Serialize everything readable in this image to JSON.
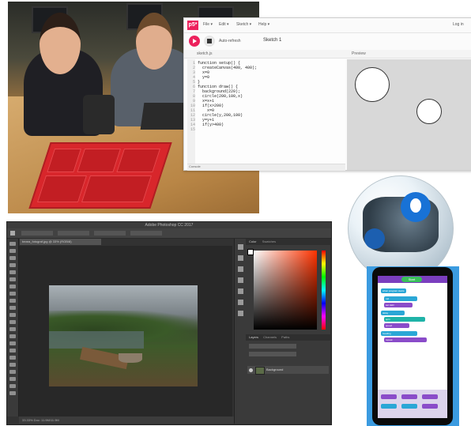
{
  "collage": {
    "p5_editor": {
      "logo": "p5*",
      "menu": [
        "File ▾",
        "Edit ▾",
        "Sketch ▾",
        "Help ▾"
      ],
      "account": "Log in",
      "auto_refresh": "Auto-refresh",
      "sketch_name": "Sketch 1",
      "file_tab": "sketch.js",
      "preview_label": "Preview",
      "console_label": "Console",
      "code_lines": [
        "function setup() {",
        "  createCanvas(400, 400);",
        "  x=0",
        "  y=0",
        "}",
        "",
        "function draw() {",
        "  background(220);",
        "  circle(200,100,x)",
        "  x=x+1",
        "  if(x>200)",
        "    x=0",
        "  circle(y,200,100)",
        "  y=y+1",
        "  if(y>400)"
      ],
      "line_numbers": [
        "1",
        "2",
        "3",
        "4",
        "5",
        "6",
        "7",
        "8",
        "9",
        "10",
        "11",
        "12",
        "13",
        "14",
        "15"
      ]
    },
    "photoshop": {
      "title": "Adobe Photoshop CC 2017",
      "doc_tab": "beara_fotograf.jpg @ 33% (RGB/8)",
      "panel_color": "Color",
      "panel_swatches": "Swatches",
      "panel_layers": "Layers",
      "layers_tabs": [
        "Layers",
        "Channels",
        "Paths"
      ],
      "layer_name": "Background",
      "status": "33.33%   Doc: 11.9M/11.9M"
    },
    "sphero_app": {
      "run_label": "Start",
      "blocks": [
        "when program starts",
        "roll",
        "set LED",
        "delay",
        "spin",
        "speed",
        "heading",
        "repeat"
      ]
    },
    "colors": {
      "p5_pink": "#ed225d",
      "ps_dark": "#323232",
      "sphero_blue": "#1872d6",
      "phone_bg": "#3b9be0",
      "block_cyan": "#2aa7d6",
      "block_purple": "#8a4cc9"
    }
  }
}
